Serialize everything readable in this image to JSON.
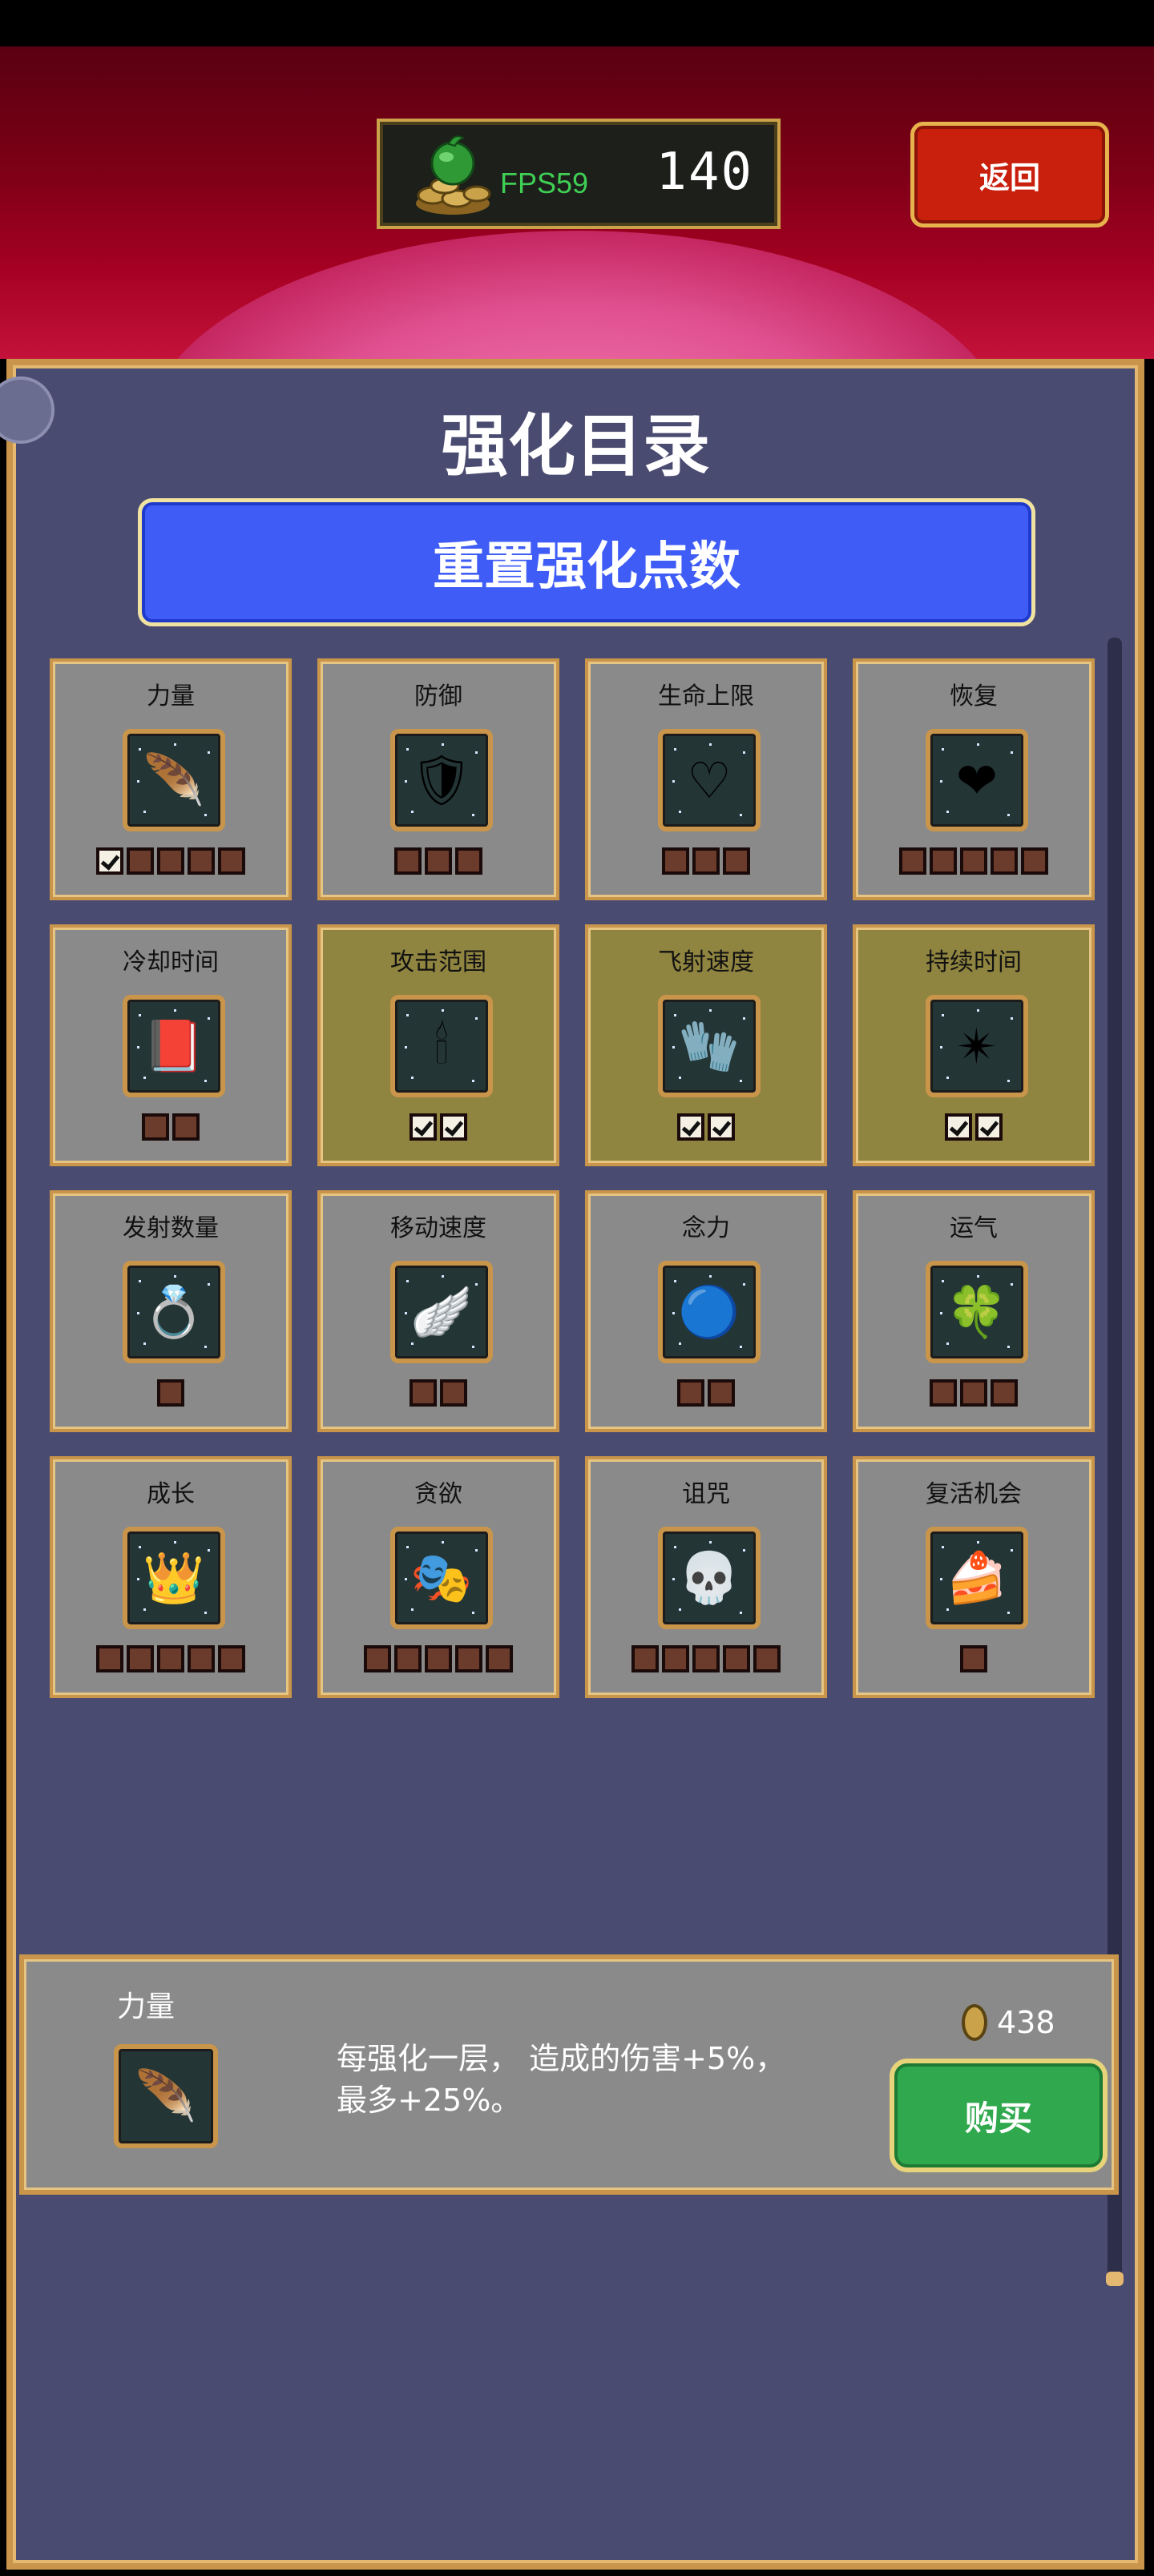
{
  "header": {
    "fps": "FPS59",
    "coins": "140",
    "back_label": "返回"
  },
  "panel": {
    "title": "强化目录",
    "reset_label": "重置强化点数"
  },
  "powerups": [
    {
      "label": "力量",
      "icon": "green-feather-icon",
      "glyph": "🪶",
      "max": 5,
      "bought": 1,
      "active": false
    },
    {
      "label": "防御",
      "icon": "armor-icon",
      "glyph": "🛡",
      "max": 3,
      "bought": 0,
      "active": false
    },
    {
      "label": "生命上限",
      "icon": "heart-outline-icon",
      "glyph": "♡",
      "max": 3,
      "bought": 0,
      "active": false
    },
    {
      "label": "恢复",
      "icon": "red-heart-icon",
      "glyph": "❤",
      "max": 5,
      "bought": 0,
      "active": false
    },
    {
      "label": "冷却时间",
      "icon": "red-tome-icon",
      "glyph": "📕",
      "max": 2,
      "bought": 0,
      "active": false
    },
    {
      "label": "攻击范围",
      "icon": "candelabra-icon",
      "glyph": "🕯",
      "max": 2,
      "bought": 2,
      "active": true
    },
    {
      "label": "飞射速度",
      "icon": "bracer-icon",
      "glyph": "🧤",
      "max": 2,
      "bought": 2,
      "active": true
    },
    {
      "label": "持续时间",
      "icon": "spellbinder-icon",
      "glyph": "✴",
      "max": 2,
      "bought": 2,
      "active": true
    },
    {
      "label": "发射数量",
      "icon": "ring-icon",
      "glyph": "💍",
      "max": 1,
      "bought": 0,
      "active": false
    },
    {
      "label": "移动速度",
      "icon": "wing-icon",
      "glyph": "🪽",
      "max": 2,
      "bought": 0,
      "active": false
    },
    {
      "label": "念力",
      "icon": "blue-orb-icon",
      "glyph": "🔵",
      "max": 2,
      "bought": 0,
      "active": false
    },
    {
      "label": "运气",
      "icon": "clover-icon",
      "glyph": "🍀",
      "max": 3,
      "bought": 0,
      "active": false
    },
    {
      "label": "成长",
      "icon": "crown-icon",
      "glyph": "👑",
      "max": 5,
      "bought": 0,
      "active": false
    },
    {
      "label": "贪欲",
      "icon": "mask-icon",
      "glyph": "🎭",
      "max": 5,
      "bought": 0,
      "active": false
    },
    {
      "label": "诅咒",
      "icon": "skull-icon",
      "glyph": "💀",
      "max": 5,
      "bought": 0,
      "active": false
    },
    {
      "label": "复活机会",
      "icon": "cake-icon",
      "glyph": "🍰",
      "max": 1,
      "bought": 0,
      "active": false
    }
  ],
  "detail": {
    "name": "力量",
    "icon": "green-feather-icon",
    "glyph": "🪶",
    "description": "每强化一层， 造成的伤害+5%，\n最多+25%。",
    "price": "438",
    "buy_label": "购买"
  },
  "colors": {
    "panel_bg": "#4a4b70",
    "reset_button": "#3f5df6",
    "buy_button": "#2fa84e",
    "back_button": "#c8200c",
    "card_active": "#8f8440",
    "card_idle": "#8a8a8a",
    "gold_border": "#c9954a"
  }
}
